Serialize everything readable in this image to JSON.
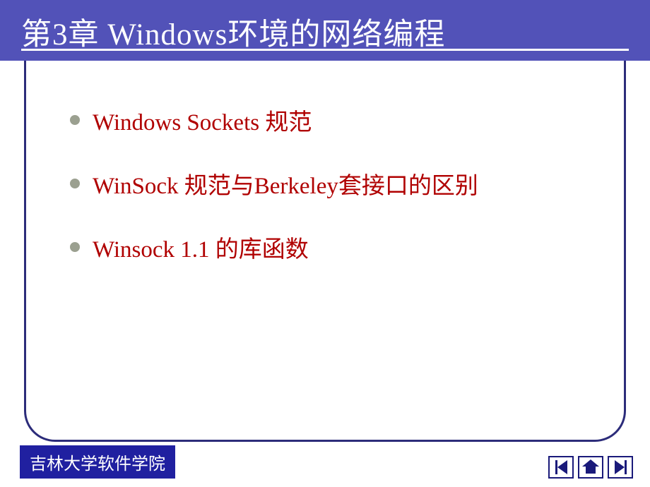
{
  "header": {
    "title": "第3章  Windows环境的网络编程"
  },
  "bullets": [
    "Windows  Sockets 规范",
    "WinSock 规范与Berkeley套接口的区别",
    "Winsock 1.1 的库函数"
  ],
  "footer": {
    "label": "吉林大学软件学院"
  },
  "colors": {
    "header_bg": "#5252b8",
    "frame_border": "#2c2c7a",
    "bullet_text": "#b00000",
    "bullet_dot": "#9ba090",
    "footer_bg": "#2020a0"
  }
}
